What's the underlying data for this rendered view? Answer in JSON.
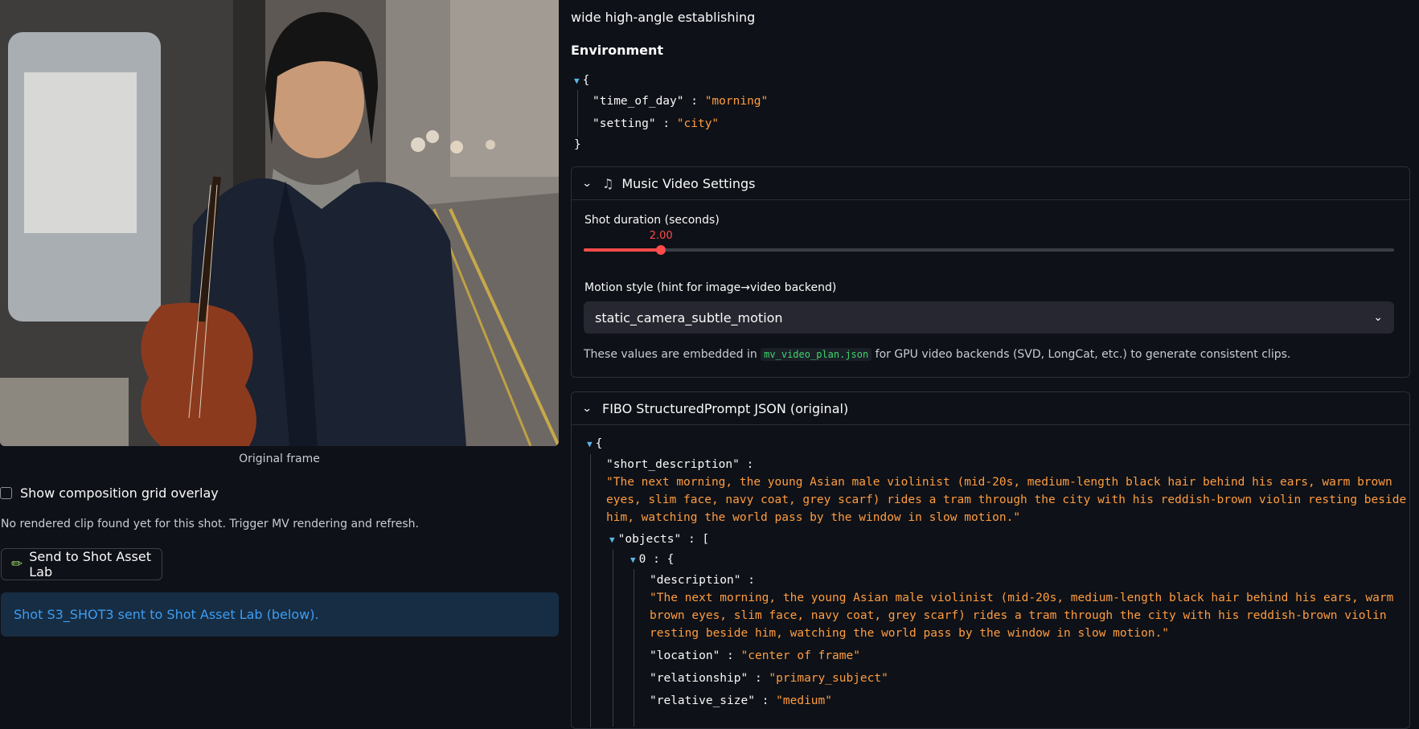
{
  "left": {
    "image_caption": "Original frame",
    "grid_overlay_label": "Show composition grid overlay",
    "grid_overlay_checked": false,
    "no_clip_message": "No rendered clip found yet for this shot. Trigger MV rendering and refresh.",
    "send_button_icon": "pencil-icon",
    "send_button_label": "Send to Shot Asset Lab",
    "alert_message": "Shot S3_SHOT3 sent to Shot Asset Lab (below)."
  },
  "right": {
    "shot_type_text": "wide high-angle establishing",
    "environment_heading": "Environment",
    "environment_json": {
      "open": "{",
      "close": "}",
      "time_of_day_key": "\"time_of_day\"",
      "time_of_day_value": "\"morning\"",
      "setting_key": "\"setting\"",
      "setting_value": "\"city\""
    },
    "music_video": {
      "title": "Music Video Settings",
      "icon": "music-note-icon",
      "duration_label": "Shot duration (seconds)",
      "duration_value": "2.00",
      "duration_fraction": 0.095,
      "motion_label": "Motion style (hint for image→video backend)",
      "motion_value": "static_camera_subtle_motion",
      "hint_before": "These values are embedded in",
      "hint_code": "mv_video_plan.json",
      "hint_after": "for GPU video backends (SVD, LongCat, etc.) to generate consistent clips."
    },
    "fibo": {
      "title": "FIBO StructuredPrompt JSON (original)",
      "open": "{",
      "short_description_key": "\"short_description\"",
      "short_description_lines": [
        "\"The next morning, the young Asian male violinist (mid-20s, medium-length black hair behind his ears, warm brown",
        "eyes, slim face, navy coat, grey scarf) rides a tram through the city with his reddish-brown violin resting beside",
        "him, watching the world pass by the window in slow motion.\""
      ],
      "objects_key": "\"objects\"",
      "objects_open": "[",
      "item_index": "0",
      "item_open": "{",
      "description_key": "\"description\"",
      "description_lines": [
        "\"The next morning, the young Asian male violinist (mid-20s, medium-length black hair behind his ears, warm",
        "brown eyes, slim face, navy coat, grey scarf) rides a tram through the city with his reddish-brown violin",
        "resting beside him, watching the world pass by the window in slow motion.\""
      ],
      "location_key": "\"location\"",
      "location_value": "\"center of frame\"",
      "relationship_key": "\"relationship\"",
      "relationship_value": "\"primary_subject\"",
      "relative_size_key": "\"relative_size\"",
      "relative_size_value": "\"medium\""
    },
    "colon": ":"
  }
}
